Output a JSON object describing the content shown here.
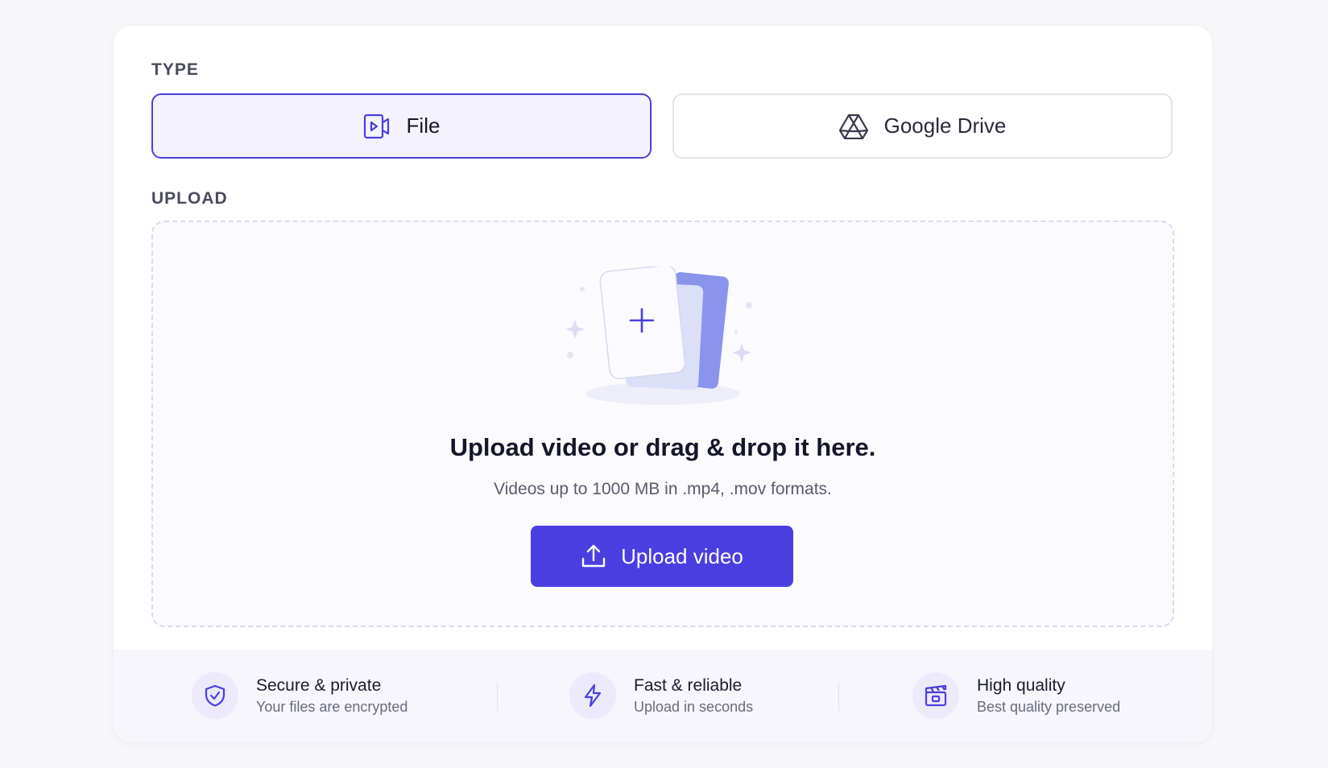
{
  "type_section": {
    "label": "TYPE",
    "options": [
      {
        "label": "File",
        "icon": "video-file-icon",
        "selected": true
      },
      {
        "label": "Google Drive",
        "icon": "google-drive-icon",
        "selected": false
      }
    ]
  },
  "upload_section": {
    "label": "UPLOAD",
    "title": "Upload video or drag & drop it here.",
    "subtitle": "Videos up to 1000 MB in .mp4, .mov formats.",
    "button_label": "Upload video",
    "button_icon": "upload-icon"
  },
  "features": [
    {
      "title": "Secure & private",
      "subtitle": "Your files are encrypted",
      "icon": "shield-check-icon"
    },
    {
      "title": "Fast & reliable",
      "subtitle": "Upload in seconds",
      "icon": "lightning-icon"
    },
    {
      "title": "High quality",
      "subtitle": "Best quality preserved",
      "icon": "clapperboard-icon"
    }
  ],
  "colors": {
    "accent": "#4b3ee0",
    "selected_bg": "#f4f3fd",
    "feature_bar_bg": "#f6f6fc"
  }
}
